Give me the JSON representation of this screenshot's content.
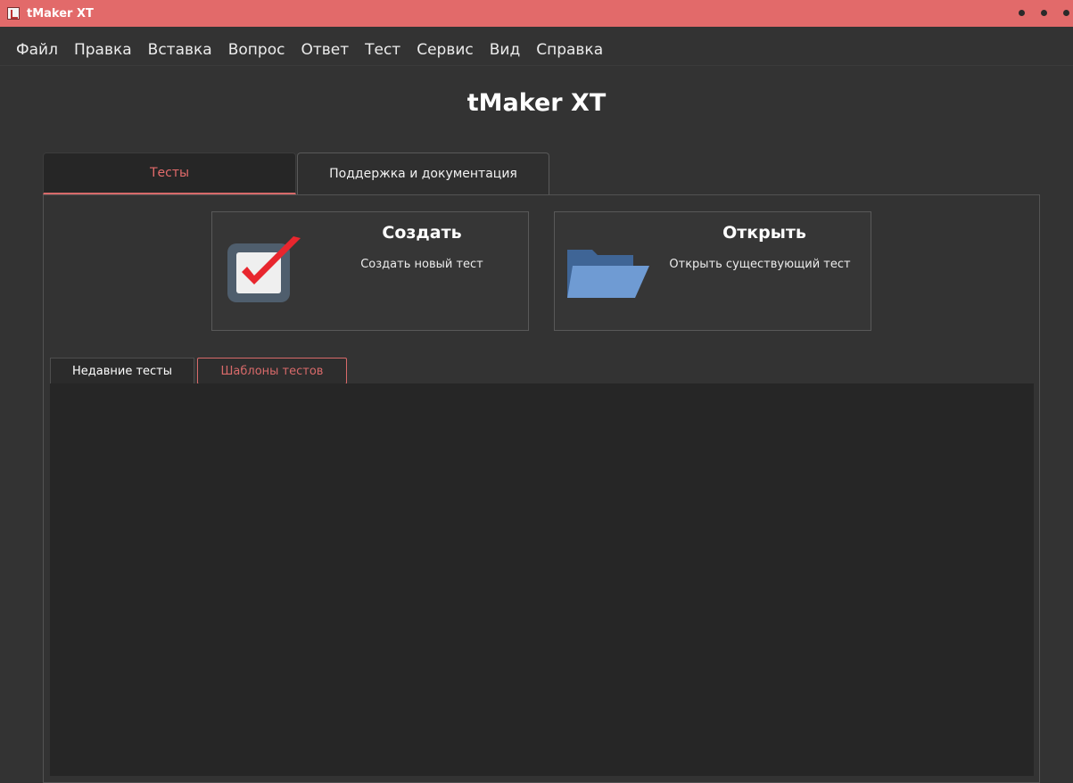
{
  "window": {
    "title": "tMaker XT",
    "title_bar_color": "#e26a6a"
  },
  "menu": {
    "items": [
      "Файл",
      "Правка",
      "Вставка",
      "Вопрос",
      "Ответ",
      "Тест",
      "Сервис",
      "Вид",
      "Справка"
    ]
  },
  "heading": "tMaker XT",
  "tabs": {
    "tests": "Тесты",
    "support": "Поддержка и документация",
    "active": "tests"
  },
  "actions": {
    "create": {
      "title": "Создать",
      "description": "Создать новый тест",
      "icon": "checkbox-icon"
    },
    "open": {
      "title": "Открыть",
      "description": "Открыть существующий тест",
      "icon": "folder-icon"
    }
  },
  "subtabs": {
    "recent": "Недавние тесты",
    "templates": "Шаблоны тестов",
    "active": "recent"
  },
  "colors": {
    "accent": "#e26a6a",
    "background": "#333333",
    "panel_dark": "#262626"
  }
}
